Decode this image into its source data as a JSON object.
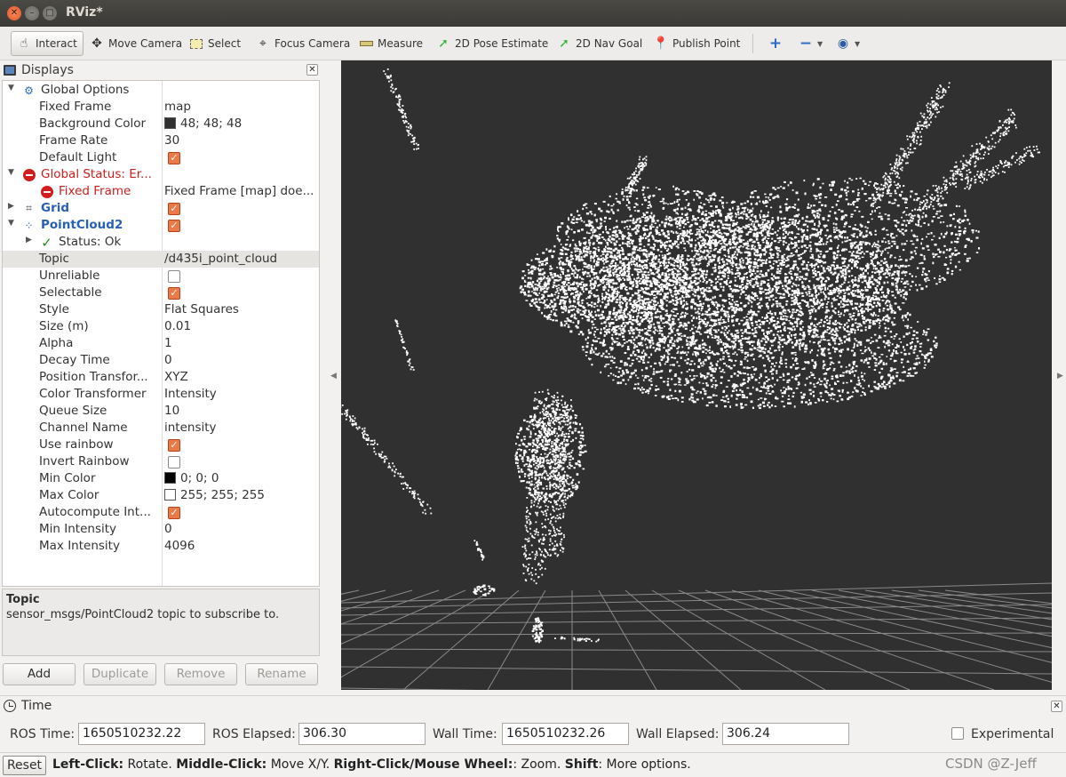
{
  "window": {
    "title": "RViz*"
  },
  "toolbar": {
    "interact": "Interact",
    "move_camera": "Move Camera",
    "select": "Select",
    "focus_camera": "Focus Camera",
    "measure": "Measure",
    "pose_estimate": "2D Pose Estimate",
    "nav_goal": "2D Nav Goal",
    "publish_point": "Publish Point"
  },
  "displays": {
    "title": "Displays",
    "global_options": "Global Options",
    "fixed_frame_label": "Fixed Frame",
    "fixed_frame_value": "map",
    "background_color_label": "Background Color",
    "background_color_value": "48; 48; 48",
    "frame_rate_label": "Frame Rate",
    "frame_rate_value": "30",
    "default_light_label": "Default Light",
    "global_status": "Global Status: Er...",
    "fixed_frame_error_label": "Fixed Frame",
    "fixed_frame_error_value": "Fixed Frame [map] doe...",
    "grid": "Grid",
    "pointcloud": "PointCloud2",
    "status_ok": "Status: Ok",
    "topic_label": "Topic",
    "topic_value": "/d435i_point_cloud",
    "unreliable": "Unreliable",
    "selectable": "Selectable",
    "style_label": "Style",
    "style_value": "Flat Squares",
    "size_label": "Size (m)",
    "size_value": "0.01",
    "alpha_label": "Alpha",
    "alpha_value": "1",
    "decay_label": "Decay Time",
    "decay_value": "0",
    "position_transformer_label": "Position Transfor...",
    "position_transformer_value": "XYZ",
    "color_transformer_label": "Color Transformer",
    "color_transformer_value": "Intensity",
    "queue_size_label": "Queue Size",
    "queue_size_value": "10",
    "channel_name_label": "Channel Name",
    "channel_name_value": "intensity",
    "use_rainbow": "Use rainbow",
    "invert_rainbow": "Invert Rainbow",
    "min_color_label": "Min Color",
    "min_color_value": "0; 0; 0",
    "max_color_label": "Max Color",
    "max_color_value": "255; 255; 255",
    "autocompute_label": "Autocompute Int...",
    "min_intensity_label": "Min Intensity",
    "min_intensity_value": "0",
    "max_intensity_label": "Max Intensity",
    "max_intensity_value": "4096"
  },
  "description": {
    "title": "Topic",
    "text": "sensor_msgs/PointCloud2 topic to subscribe to."
  },
  "panel_buttons": {
    "add": "Add",
    "duplicate": "Duplicate",
    "remove": "Remove",
    "rename": "Rename"
  },
  "time": {
    "title": "Time",
    "ros_time_label": "ROS Time:",
    "ros_time_value": "1650510232.22",
    "ros_elapsed_label": "ROS Elapsed:",
    "ros_elapsed_value": "306.30",
    "wall_time_label": "Wall Time:",
    "wall_time_value": "1650510232.26",
    "wall_elapsed_label": "Wall Elapsed:",
    "wall_elapsed_value": "306.24",
    "experimental": "Experimental"
  },
  "status": {
    "reset": "Reset",
    "left_click": "Left-Click:",
    "left_click_action": " Rotate. ",
    "middle_click": "Middle-Click:",
    "middle_click_action": " Move X/Y. ",
    "right_click": "Right-Click/Mouse Wheel:",
    "right_click_action": ": Zoom. ",
    "shift": "Shift",
    "shift_action": ": More options.",
    "watermark": "CSDN @Z-Jeff"
  },
  "colors": {
    "background": "#303030",
    "error": "#c8201e",
    "checkbox": "#ec7a48",
    "display_name": "#2860b8"
  }
}
